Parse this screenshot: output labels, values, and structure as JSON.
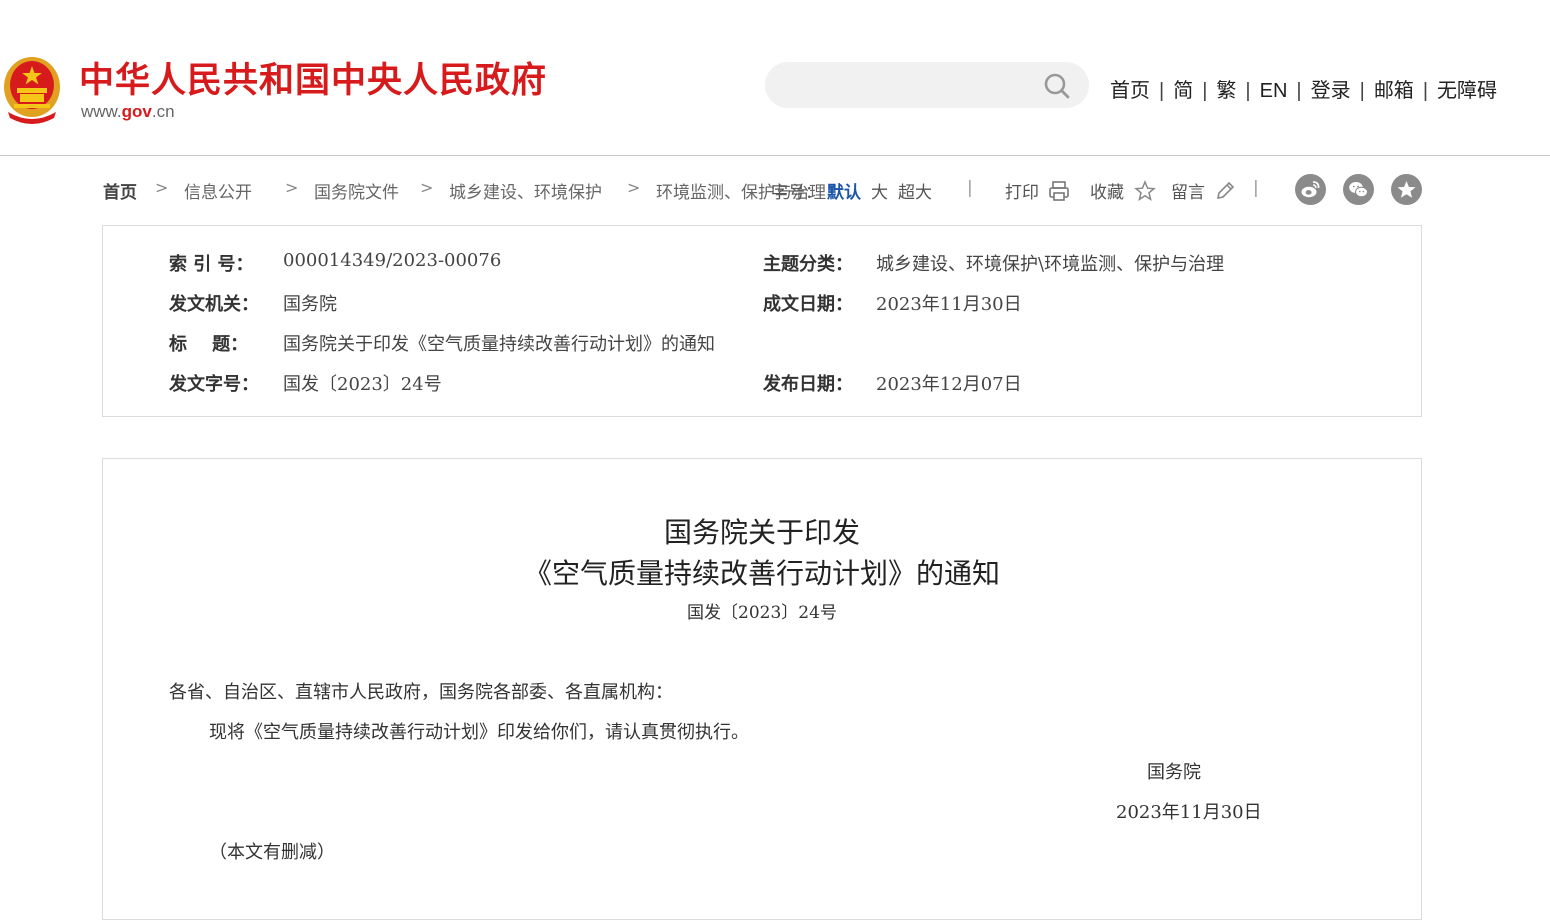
{
  "header": {
    "site_title": "中华人民共和国中央人民政府",
    "site_url_prefix": "www.",
    "site_url_accent": "gov",
    "site_url_suffix": ".cn",
    "search_placeholder": "",
    "search_icon": "search-icon",
    "nav": [
      "首页",
      "简",
      "繁",
      "EN",
      "登录",
      "邮箱",
      "无障碍"
    ],
    "nav_separator": "|"
  },
  "breadcrumb": {
    "home": "首页",
    "items": [
      "信息公开",
      "国务院文件",
      "城乡建设、环境保护",
      "环境监测、保护与治理"
    ],
    "separator": ">"
  },
  "font_size": {
    "label": "字号：",
    "options": [
      "默认",
      "大",
      "超大"
    ],
    "active": "默认"
  },
  "tools": {
    "print": "打印",
    "favorite": "收藏",
    "comment": "留言",
    "divider": "|"
  },
  "share_icons": [
    "weibo-icon",
    "wechat-icon",
    "xuexi-star-icon"
  ],
  "meta": {
    "index_no_label": "索 引 号：",
    "index_no": "000014349/2023-00076",
    "topic_label": "主题分类：",
    "topic": "城乡建设、环境保护\\环境监测、保护与治理",
    "issuer_label": "发文机关：",
    "issuer": "国务院",
    "written_date_label": "成文日期：",
    "written_date": "2023年11月30日",
    "title_label": "标    题：",
    "title": "国务院关于印发《空气质量持续改善行动计划》的通知",
    "doc_no_label": "发文字号：",
    "doc_no": "国发〔2023〕24号",
    "publish_date_label": "发布日期：",
    "publish_date": "2023年12月07日"
  },
  "document": {
    "title_line1": "国务院关于印发",
    "title_line2": "《空气质量持续改善行动计划》的通知",
    "number": "国发〔2023〕24号",
    "salutation": "各省、自治区、直辖市人民政府，国务院各部委、各直属机构：",
    "body": "现将《空气质量持续改善行动计划》印发给你们，请认真贯彻执行。",
    "signature": "国务院",
    "date": "2023年11月30日",
    "note": "（本文有删减）"
  },
  "colors": {
    "brand_red": "#d71a1b",
    "active_blue": "#1b57a8",
    "share_gray": "#8b8b8b"
  }
}
